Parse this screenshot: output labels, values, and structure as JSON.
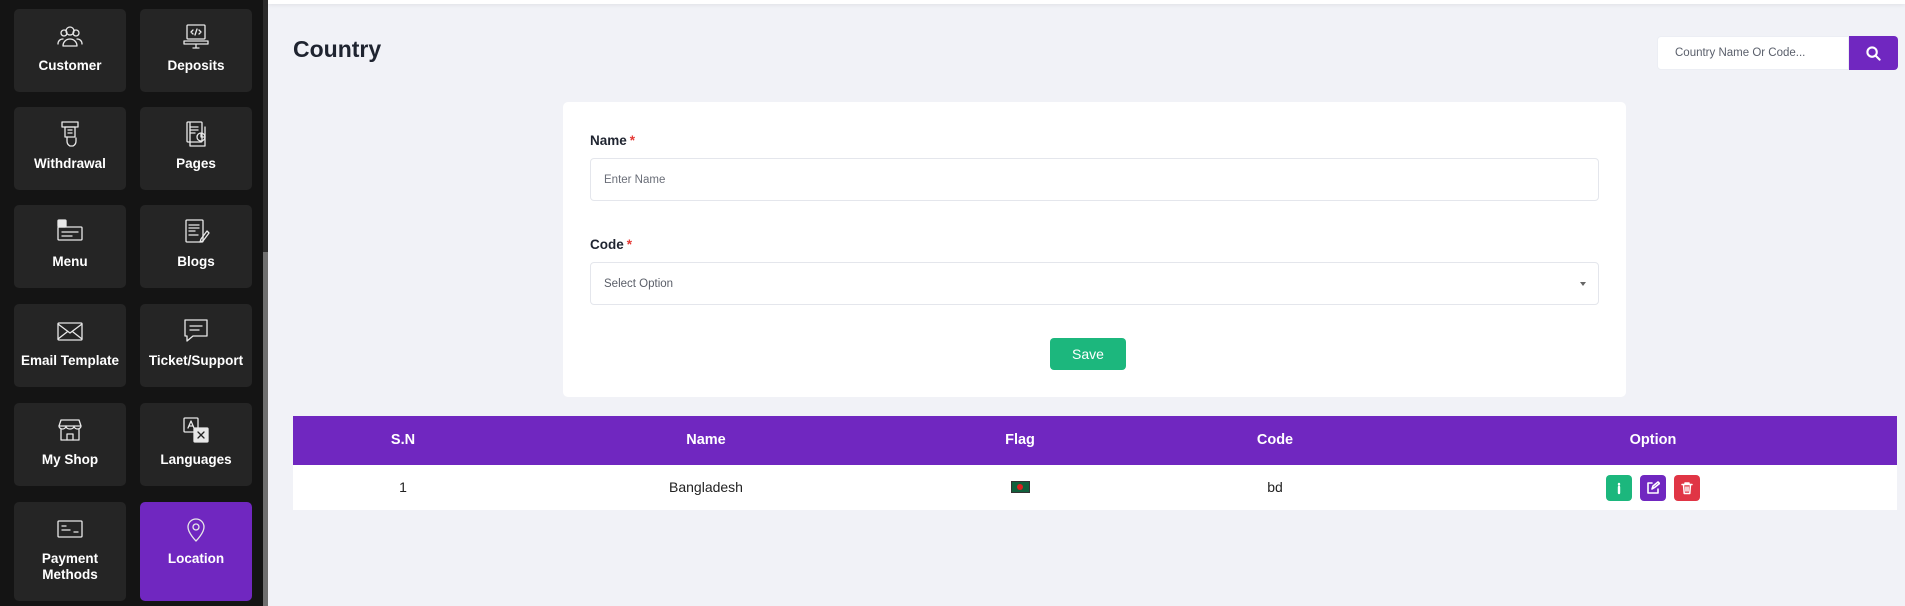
{
  "sidebar": {
    "tiles": [
      {
        "label": "Customer",
        "icon": "customer-icon"
      },
      {
        "label": "Deposits",
        "icon": "deposits-icon"
      },
      {
        "label": "Withdrawal",
        "icon": "withdrawal-icon"
      },
      {
        "label": "Pages",
        "icon": "pages-icon"
      },
      {
        "label": "Menu",
        "icon": "menu-icon"
      },
      {
        "label": "Blogs",
        "icon": "blogs-icon"
      },
      {
        "label": "Email Template",
        "icon": "email-icon"
      },
      {
        "label": "Ticket/Support",
        "icon": "ticket-icon"
      },
      {
        "label": "My Shop",
        "icon": "shop-icon"
      },
      {
        "label": "Languages",
        "icon": "languages-icon"
      },
      {
        "label": "Payment Methods",
        "icon": "payment-icon"
      },
      {
        "label": "Location",
        "icon": "location-icon"
      }
    ],
    "active": "Location",
    "active_color": "#7027c0"
  },
  "page": {
    "title": "Country"
  },
  "search": {
    "placeholder": "Country Name Or Code...",
    "value": "",
    "icon": "search-icon"
  },
  "form": {
    "name_label": "Name",
    "name_placeholder": "Enter Name",
    "name_value": "",
    "code_label": "Code",
    "code_placeholder": "Select Option",
    "required_mark": "*",
    "save_label": "Save"
  },
  "table": {
    "headers": {
      "sn": "S.N",
      "name": "Name",
      "flag": "Flag",
      "code": "Code",
      "option": "Option"
    },
    "rows": [
      {
        "sn": "1",
        "name": "Bangladesh",
        "flag": "bd-flag-icon",
        "code": "bd"
      }
    ]
  },
  "colors": {
    "primary": "#7027c0",
    "success": "#1cb77d",
    "danger": "#e03545",
    "sidebar_bg": "#141414",
    "tile_bg": "#252525"
  }
}
